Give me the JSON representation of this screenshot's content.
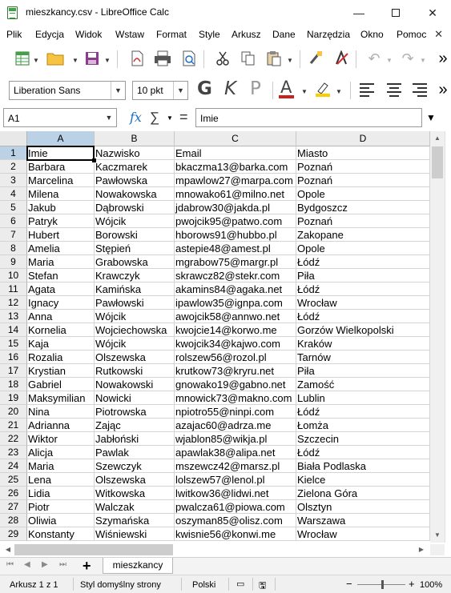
{
  "window": {
    "title": "mieszkancy.csv - LibreOffice Calc",
    "minimize": "—",
    "close": "✕"
  },
  "menu": [
    "Plik",
    "Edycja",
    "Widok",
    "Wstaw",
    "Format",
    "Style",
    "Arkusz",
    "Dane",
    "Narzędzia",
    "Okno",
    "Pomoc"
  ],
  "menu_close": "✕",
  "toolbar": {
    "font_name": "Liberation Sans",
    "font_size": "10 pkt",
    "bold": "G",
    "italic": "K",
    "underline": "P",
    "font_color": "A",
    "overflow": "»"
  },
  "formula": {
    "cell_ref": "A1",
    "fx": "fx",
    "sigma": "∑",
    "equals": "=",
    "content": "Imie"
  },
  "columns": [
    "A",
    "B",
    "C",
    "D"
  ],
  "rows": [
    [
      "Imie",
      "Nazwisko",
      "Email",
      "Miasto"
    ],
    [
      "Barbara",
      "Kaczmarek",
      "bkaczma13@barka.com",
      "Poznań"
    ],
    [
      "Marcelina",
      "Pawłowska",
      "mpawlow27@marpa.com",
      "Poznań"
    ],
    [
      "Milena",
      "Nowakowska",
      "mnowako61@milno.net",
      "Opole"
    ],
    [
      "Jakub",
      "Dąbrowski",
      "jdabrow30@jakda.pl",
      "Bydgoszcz"
    ],
    [
      "Patryk",
      "Wójcik",
      "pwojcik95@patwo.com",
      "Poznań"
    ],
    [
      "Hubert",
      "Borowski",
      "hborows91@hubbo.pl",
      "Zakopane"
    ],
    [
      "Amelia",
      "Stępień",
      "astepie48@amest.pl",
      "Opole"
    ],
    [
      "Maria",
      "Grabowska",
      "mgrabow75@margr.pl",
      "Łódź"
    ],
    [
      "Stefan",
      "Krawczyk",
      "skrawcz82@stekr.com",
      "Piła"
    ],
    [
      "Agata",
      "Kamińska",
      "akamins84@agaka.net",
      "Łódź"
    ],
    [
      "Ignacy",
      "Pawłowski",
      "ipawlow35@ignpa.com",
      "Wrocław"
    ],
    [
      "Anna",
      "Wójcik",
      "awojcik58@annwo.net",
      "Łódź"
    ],
    [
      "Kornelia",
      "Wojciechowska",
      "kwojcie14@korwo.me",
      "Gorzów Wielkopolski"
    ],
    [
      "Kaja",
      "Wójcik",
      "kwojcik34@kajwo.com",
      "Kraków"
    ],
    [
      "Rozalia",
      "Olszewska",
      "rolszew56@rozol.pl",
      "Tarnów"
    ],
    [
      "Krystian",
      "Rutkowski",
      "krutkow73@kryru.net",
      "Piła"
    ],
    [
      "Gabriel",
      "Nowakowski",
      "gnowako19@gabno.net",
      "Zamość"
    ],
    [
      "Maksymilian",
      "Nowicki",
      "mnowick73@makno.com",
      "Lublin"
    ],
    [
      "Nina",
      "Piotrowska",
      "npiotro55@ninpi.com",
      "Łódź"
    ],
    [
      "Adrianna",
      "Zając",
      "azajac60@adrza.me",
      "Łomża"
    ],
    [
      "Wiktor",
      "Jabłoński",
      "wjablon85@wikja.pl",
      "Szczecin"
    ],
    [
      "Alicja",
      "Pawlak",
      "apawlak38@alipa.net",
      "Łódź"
    ],
    [
      "Maria",
      "Szewczyk",
      "mszewcz42@marsz.pl",
      "Biała Podlaska"
    ],
    [
      "Lena",
      "Olszewska",
      "lolszew57@lenol.pl",
      "Kielce"
    ],
    [
      "Lidia",
      "Witkowska",
      "lwitkow36@lidwi.net",
      "Zielona Góra"
    ],
    [
      "Piotr",
      "Walczak",
      "pwalcza61@piowa.com",
      "Olsztyn"
    ],
    [
      "Oliwia",
      "Szymańska",
      "oszyman85@olisz.com",
      "Warszawa"
    ],
    [
      "Konstanty",
      "Wiśniewski",
      "kwisnie56@konwi.me",
      "Wrocław"
    ]
  ],
  "sheet": {
    "add": "+",
    "tab": "mieszkancy"
  },
  "status": {
    "position": "Arkusz 1 z 1",
    "style": "Styl domyślny strony",
    "language": "Polski",
    "zoom_minus": "−",
    "zoom_plus": "+",
    "zoom": "100%"
  }
}
